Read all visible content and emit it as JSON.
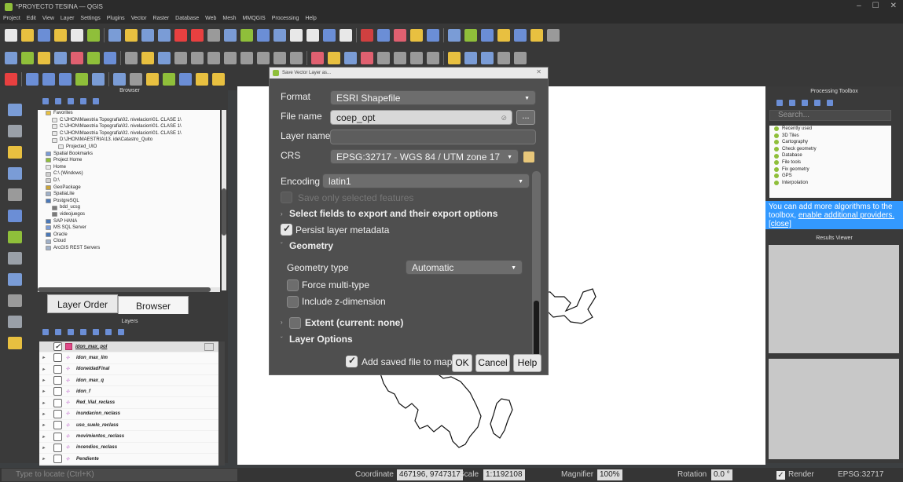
{
  "window": {
    "title": "*PROYECTO TESINA — QGIS",
    "controls": [
      "–",
      "☐",
      "✕"
    ]
  },
  "menu": [
    "Project",
    "Edit",
    "View",
    "Layer",
    "Settings",
    "Plugins",
    "Vector",
    "Raster",
    "Database",
    "Web",
    "Mesh",
    "MMQGIS",
    "Processing",
    "Help"
  ],
  "browser_panel": {
    "title": "Browser",
    "tree": [
      {
        "label": "Favorites",
        "indent": 1,
        "icon": "star-icon",
        "color": "#e8c040"
      },
      {
        "label": "C:\\JHON\\Maestria Topografia\\02. nivelacion\\01. CLASE 1\\",
        "indent": 2,
        "icon": "folder-icon",
        "color": "#e8e8e8"
      },
      {
        "label": "C:\\JHON\\Maestria Topografia\\02. nivelacion\\01. CLASE 1\\",
        "indent": 2,
        "icon": "folder-icon",
        "color": "#e8e8e8"
      },
      {
        "label": "C:\\JHON\\Maestria Topografia\\02. nivelacion\\01. CLASE 1\\",
        "indent": 2,
        "icon": "folder-icon",
        "color": "#e8e8e8"
      },
      {
        "label": "D:\\JHON\\MAESTRIA\\13. ide\\Catastro_Quito",
        "indent": 2,
        "icon": "folder-icon",
        "color": "#e8e8e8"
      },
      {
        "label": "Projected_UIO",
        "indent": 3,
        "icon": "folder-icon",
        "color": "#e8e8e8"
      },
      {
        "label": "Spatial Bookmarks",
        "indent": 1,
        "icon": "bookmark-icon",
        "color": "#7a9cd6"
      },
      {
        "label": "Project Home",
        "indent": 1,
        "icon": "project-home-icon",
        "color": "#8fbf3a"
      },
      {
        "label": "Home",
        "indent": 1,
        "icon": "home-icon",
        "color": "#e8e8e8"
      },
      {
        "label": "C:\\ (Windows)",
        "indent": 1,
        "icon": "drive-icon",
        "color": "#cfcfcf"
      },
      {
        "label": "D:\\",
        "indent": 1,
        "icon": "drive-icon",
        "color": "#cfcfcf"
      },
      {
        "label": "GeoPackage",
        "indent": 1,
        "icon": "geopackage-icon",
        "color": "#c9a33a"
      },
      {
        "label": "SpatiaLite",
        "indent": 1,
        "icon": "spatialite-icon",
        "color": "#9fb0c8"
      },
      {
        "label": "PostgreSQL",
        "indent": 1,
        "icon": "postgresql-icon",
        "color": "#4a78b8"
      },
      {
        "label": "bdd_ucsg",
        "indent": 2,
        "icon": "pg-connection-icon",
        "color": "#7a7a7a"
      },
      {
        "label": "videojuegos",
        "indent": 2,
        "icon": "pg-connection-icon",
        "color": "#7a7a7a"
      },
      {
        "label": "SAP HANA",
        "indent": 1,
        "icon": "hana-icon",
        "color": "#4a78b8"
      },
      {
        "label": "MS SQL Server",
        "indent": 1,
        "icon": "mssql-icon",
        "color": "#7a9cd6"
      },
      {
        "label": "Oracle",
        "indent": 1,
        "icon": "oracle-icon",
        "color": "#4a78b8"
      },
      {
        "label": "Cloud",
        "indent": 1,
        "icon": "cloud-icon",
        "color": "#9fb0c8"
      },
      {
        "label": "ArcGIS REST Servers",
        "indent": 1,
        "icon": "arcgis-icon",
        "color": "#9fb0c8"
      }
    ],
    "tabs": [
      "Layer Order",
      "Browser"
    ]
  },
  "layers_panel": {
    "title": "Layers",
    "layers": [
      {
        "name": "idon_max_pol",
        "checked": true,
        "selected": true,
        "type": "polygon"
      },
      {
        "name": "idon_max_lim",
        "checked": false,
        "selected": false,
        "type": "raster"
      },
      {
        "name": "IdoneidadFinal",
        "checked": false,
        "selected": false,
        "type": "raster"
      },
      {
        "name": "idon_max_q",
        "checked": false,
        "selected": false,
        "type": "raster"
      },
      {
        "name": "idon_f",
        "checked": false,
        "selected": false,
        "type": "raster"
      },
      {
        "name": "Red_Vial_reclass",
        "checked": false,
        "selected": false,
        "type": "raster"
      },
      {
        "name": "inundacion_reclass",
        "checked": false,
        "selected": false,
        "type": "raster"
      },
      {
        "name": "uso_suelo_reclass",
        "checked": false,
        "selected": false,
        "type": "raster"
      },
      {
        "name": "movimientos_reclass",
        "checked": false,
        "selected": false,
        "type": "raster"
      },
      {
        "name": "incendios_reclass",
        "checked": false,
        "selected": false,
        "type": "raster"
      },
      {
        "name": "Pendiente",
        "checked": false,
        "selected": false,
        "type": "raster"
      }
    ]
  },
  "processing_toolbox": {
    "title": "Processing Toolbox",
    "search_placeholder": "Search...",
    "items": [
      "Recently used",
      "3D Tiles",
      "Cartography",
      "Check geometry",
      "Database",
      "File tools",
      "Fix geometry",
      "GPS",
      "Interpolation"
    ],
    "notice": {
      "text": "You can add more algorithms to the toolbox,",
      "link1": "enable additional providers.",
      "link2": "[close]"
    }
  },
  "results_viewer": {
    "title": "Results Viewer"
  },
  "dialog": {
    "title": "Save Vector Layer as...",
    "format_label": "Format",
    "format_value": "ESRI Shapefile",
    "file_name_label": "File name",
    "file_name_value": "coep_opt",
    "browse_label": "...",
    "layer_name_label": "Layer name",
    "layer_name_value": "",
    "crs_label": "CRS",
    "crs_value": "EPSG:32717 - WGS 84 / UTM zone 17",
    "encoding_label": "Encoding",
    "encoding_value": "latin1",
    "save_selected_label": "Save only selected features",
    "select_fields_label": "Select fields to export and their export options",
    "persist_metadata_label": "Persist layer metadata",
    "geometry_section": "Geometry",
    "geometry_type_label": "Geometry type",
    "geometry_type_value": "Automatic",
    "force_multi_label": "Force multi-type",
    "include_z_label": "Include z-dimension",
    "extent_label": "Extent (current: none)",
    "layer_options_label": "Layer Options",
    "add_to_map_label": "Add saved file to map",
    "ok_label": "OK",
    "cancel_label": "Cancel",
    "help_label": "Help"
  },
  "status_bar": {
    "locate_placeholder": "Type to locate (Ctrl+K)",
    "coordinate_label": "Coordinate",
    "coordinate_value": "467196, 9747317",
    "scale_label": "Scale",
    "scale_value": "1:1192108",
    "magnifier_label": "Magnifier",
    "magnifier_value": "100%",
    "rotation_label": "Rotation",
    "rotation_value": "0.0 °",
    "render_label": "Render",
    "crs_label": "EPSG:32717"
  }
}
